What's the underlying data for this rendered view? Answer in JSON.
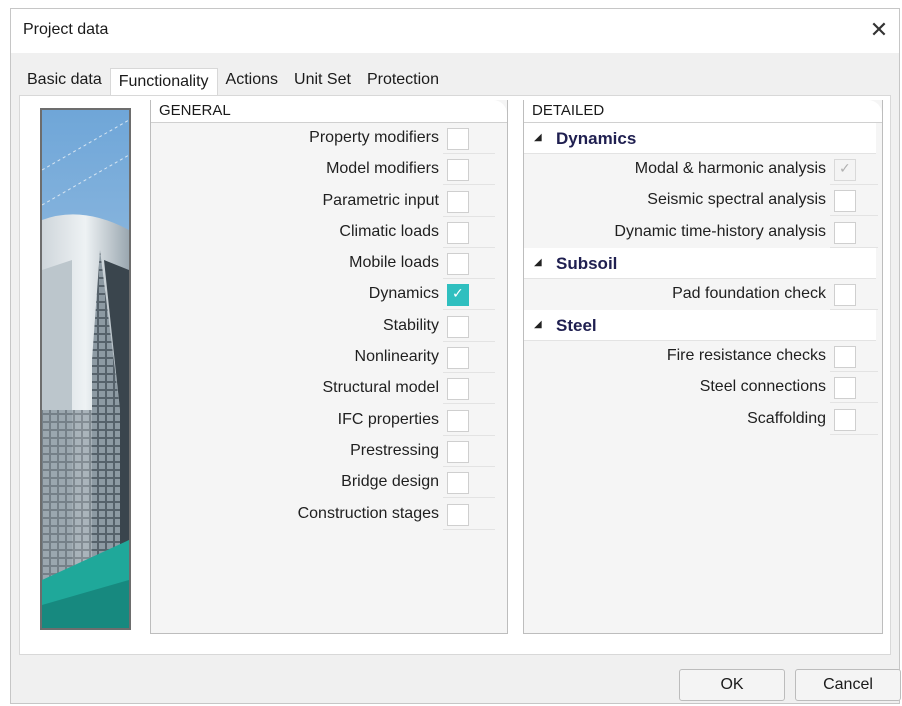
{
  "window": {
    "title": "Project data",
    "close_glyph": "✕"
  },
  "tabs": [
    {
      "label": "Basic data",
      "active": false
    },
    {
      "label": "Functionality",
      "active": true
    },
    {
      "label": "Actions",
      "active": false
    },
    {
      "label": "Unit Set",
      "active": false
    },
    {
      "label": "Protection",
      "active": false
    }
  ],
  "general": {
    "header": "GENERAL",
    "items": [
      {
        "label": "Property modifiers",
        "checked": false
      },
      {
        "label": "Model modifiers",
        "checked": false
      },
      {
        "label": "Parametric input",
        "checked": false
      },
      {
        "label": "Climatic loads",
        "checked": false
      },
      {
        "label": "Mobile loads",
        "checked": false
      },
      {
        "label": "Dynamics",
        "checked": true
      },
      {
        "label": "Stability",
        "checked": false
      },
      {
        "label": "Nonlinearity",
        "checked": false
      },
      {
        "label": "Structural model",
        "checked": false
      },
      {
        "label": "IFC properties",
        "checked": false
      },
      {
        "label": "Prestressing",
        "checked": false
      },
      {
        "label": "Bridge design",
        "checked": false
      },
      {
        "label": "Construction stages",
        "checked": false
      }
    ]
  },
  "detailed": {
    "header": "DETAILED",
    "groups": [
      {
        "label": "Dynamics",
        "items": [
          {
            "label": "Modal & harmonic analysis",
            "checked": true,
            "disabled": true
          },
          {
            "label": "Seismic spectral analysis",
            "checked": false
          },
          {
            "label": "Dynamic time-history analysis",
            "checked": false
          }
        ]
      },
      {
        "label": "Subsoil",
        "items": [
          {
            "label": "Pad foundation check",
            "checked": false
          }
        ]
      },
      {
        "label": "Steel",
        "items": [
          {
            "label": "Fire resistance checks",
            "checked": false
          },
          {
            "label": "Steel connections",
            "checked": false
          },
          {
            "label": "Scaffolding",
            "checked": false
          }
        ]
      }
    ]
  },
  "buttons": {
    "ok": "OK",
    "cancel": "Cancel"
  },
  "colors": {
    "accent_checked": "#2fbfbf",
    "group_label": "#1f1f50",
    "image_teal": "#1fa89a"
  }
}
